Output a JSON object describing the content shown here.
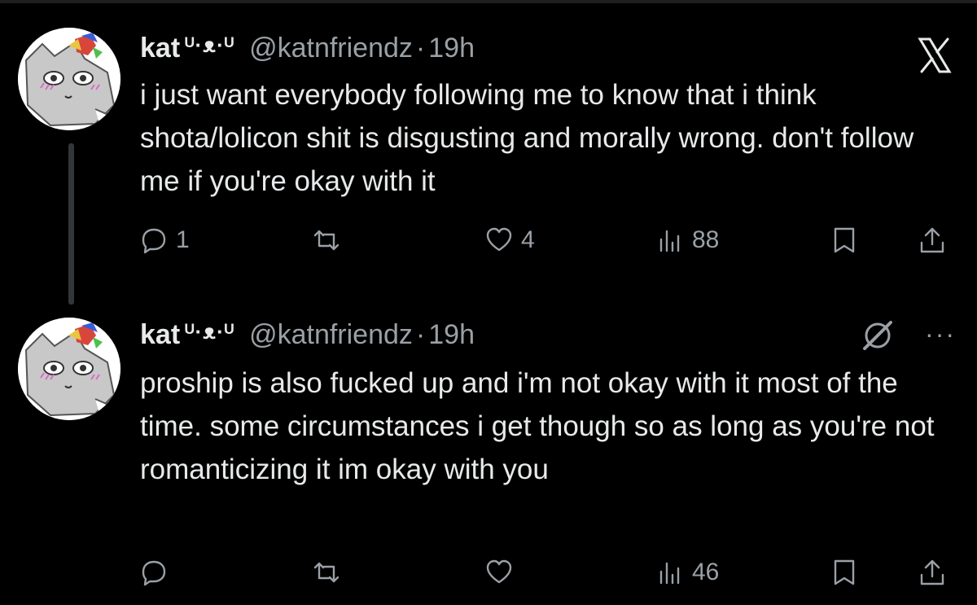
{
  "tweets": [
    {
      "name": "kat",
      "name_deco": "ᵁ·ᴥ·ᵁ",
      "handle": "@katnfriendz",
      "separator": "·",
      "time": "19h",
      "text": "i just want everybody following me to know that i think shota/lolicon shit is disgusting and morally wrong. don't follow me if you're okay with it",
      "replies": "1",
      "retweets": "",
      "likes": "4",
      "views": "88"
    },
    {
      "name": "kat",
      "name_deco": "ᵁ·ᴥ·ᵁ",
      "handle": "@katnfriendz",
      "separator": "·",
      "time": "19h",
      "text": "proship is also fucked up and i'm not okay with it most of the time. some circumstances i get though so as long as you're not romanticizing it im okay with you",
      "replies": "",
      "retweets": "",
      "likes": "",
      "views": "46"
    }
  ],
  "more_icon_text": "···",
  "icons": [
    "x-logo-icon",
    "reply-icon",
    "retweet-icon",
    "like-icon",
    "views-icon",
    "bookmark-icon",
    "share-icon",
    "more-icon",
    "hidden-reply-icon"
  ],
  "colors": {
    "background": "#000000",
    "text": "#e7e9ea",
    "muted": "#9aa0a6",
    "thread": "#333639"
  }
}
